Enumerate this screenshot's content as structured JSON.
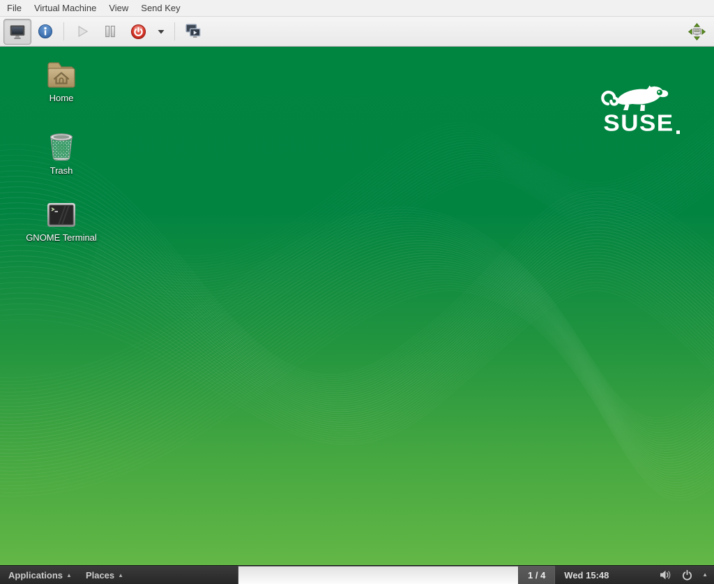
{
  "menubar": {
    "items": [
      {
        "label": "File"
      },
      {
        "label": "Virtual Machine"
      },
      {
        "label": "View"
      },
      {
        "label": "Send Key"
      }
    ]
  },
  "toolbar": {
    "active_button": "console",
    "icons": [
      "console-monitor-icon",
      "info-icon",
      "play-icon",
      "pause-icon",
      "shutdown-power-icon",
      "dropdown-arrow-icon",
      "dual-monitor-play-icon",
      "resize-to-vm-icon"
    ]
  },
  "desktop": {
    "icons": [
      {
        "label": "Home",
        "icon": "home-folder-icon"
      },
      {
        "label": "Trash",
        "icon": "trash-can-icon"
      },
      {
        "label": "GNOME Terminal",
        "icon": "terminal-icon"
      }
    ],
    "logo": {
      "wordmark": "SUSE",
      "icon": "suse-chameleon-icon"
    }
  },
  "panel": {
    "applications_label": "Applications",
    "places_label": "Places",
    "menu_arrow_glyph": "▲",
    "workspace_indicator": "1 / 4",
    "clock": "Wed 15:48",
    "tray_icons": [
      "volume-icon",
      "power-icon",
      "up-arrow-icon"
    ]
  },
  "colors": {
    "desktop_green_top": "#008540",
    "desktop_green_bottom": "#63b746",
    "suse_green": "#008a3c",
    "panel_dark": "#2e2e2e",
    "tasklist_light": "#f0f0f0",
    "shutdown_red": "#c62c1f",
    "info_blue": "#3c74b4"
  }
}
